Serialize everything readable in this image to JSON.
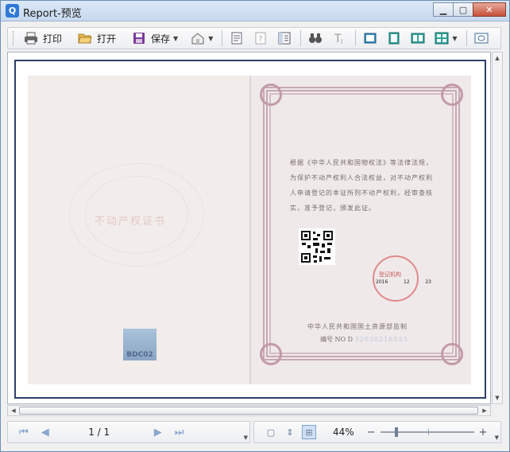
{
  "window": {
    "title": "Report-预览",
    "app_icon": "Q",
    "controls": [
      "minimize",
      "maximize",
      "close"
    ]
  },
  "toolbar": {
    "print_label": "打印",
    "open_label": "打开",
    "save_label": "保存"
  },
  "document": {
    "left_page": {
      "title": "不动产权证书",
      "emblem_text": "BDC02"
    },
    "right_page": {
      "law_text": "根据《中华人民共和国物权法》等法律法规，为保护不动产权利人合法权益，对不动产权利人申请登记的本证所列不动产权利，经审查核实，准予登记，颁发此证。",
      "seal_text": "登记机构",
      "date": {
        "year": "2016",
        "month": "12",
        "day": "23"
      },
      "issuer": "中华人民共和国国土资源部监制",
      "serial_label": "编号 NO D",
      "serial_number": "32030216533"
    }
  },
  "status": {
    "page_indicator": "1 / 1",
    "zoom": "44%",
    "zoom_level_fraction": 0.44
  },
  "colors": {
    "frame": "#2d3f68",
    "accent": "#2f7ad6"
  }
}
